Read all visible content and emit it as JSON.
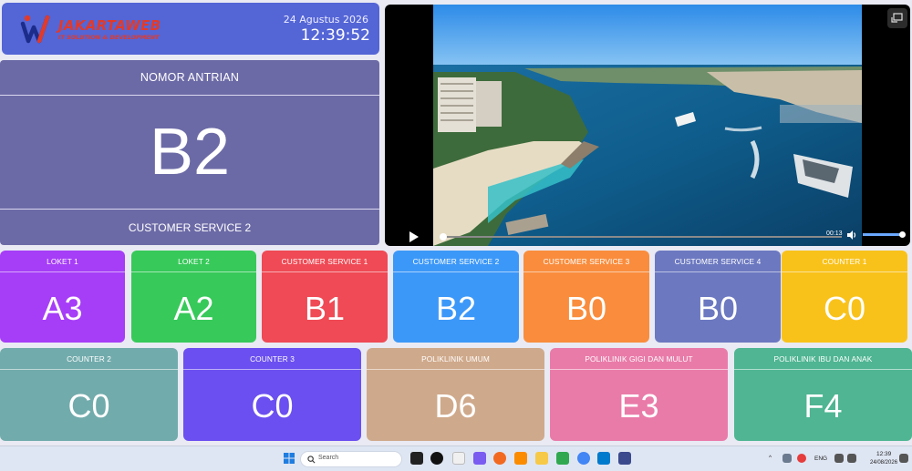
{
  "header": {
    "logo_text": "JAKARTAWEB",
    "logo_subtext": "IT SOLUTION & DEVELOPMENT",
    "date": "24 Agustus 2026",
    "time": "12:39:52",
    "color": "#5465d6"
  },
  "queue": {
    "title": "NOMOR ANTRIAN",
    "number": "B2",
    "service": "CUSTOMER SERVICE 2",
    "color": "#6c6aa6"
  },
  "video": {
    "time": "00:13",
    "play_icon": "play-icon",
    "volume_icon": "volume-icon",
    "fullscreen_icon": "fullscreen-icon"
  },
  "tiles_row1": [
    {
      "label": "LOKET 1",
      "value": "A3",
      "color": "#a63df7"
    },
    {
      "label": "LOKET 2",
      "value": "A2",
      "color": "#37c95a"
    },
    {
      "label": "CUSTOMER SERVICE 1",
      "value": "B1",
      "color": "#ef4a55"
    },
    {
      "label": "CUSTOMER SERVICE 2",
      "value": "B2",
      "color": "#3c98f8"
    },
    {
      "label": "CUSTOMER SERVICE 3",
      "value": "B0",
      "color": "#f98d3d"
    },
    {
      "label": "CUSTOMER SERVICE 4",
      "value": "B0",
      "color": "#6c78c0"
    },
    {
      "label": "COUNTER 1",
      "value": "C0",
      "color": "#f9c21b"
    }
  ],
  "tiles_row2": [
    {
      "label": "COUNTER 2",
      "value": "C0",
      "color": "#72abac"
    },
    {
      "label": "COUNTER 3",
      "value": "C0",
      "color": "#6b4ff0"
    },
    {
      "label": "POLIKLINIK UMUM",
      "value": "D6",
      "color": "#cfa98b"
    },
    {
      "label": "POLIKLINIK GIGI DAN MULUT",
      "value": "E3",
      "color": "#e97ba9"
    },
    {
      "label": "POLIKLINIK IBU DAN ANAK",
      "value": "F4",
      "color": "#4fb592"
    }
  ],
  "taskbar": {
    "search_placeholder": "Search",
    "tray_lang": "ENG",
    "tray_time": "12:39",
    "tray_date": "24/08/2026"
  }
}
